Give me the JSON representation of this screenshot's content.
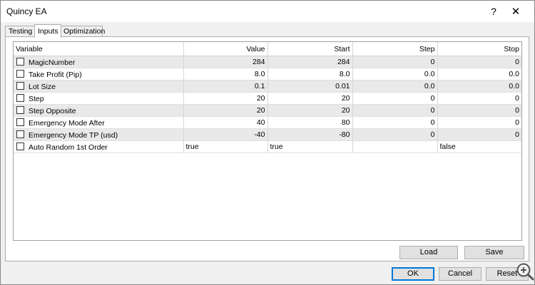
{
  "window": {
    "title": "Quincy EA",
    "help_glyph": "?",
    "close_glyph": "✕"
  },
  "tabs": [
    {
      "label": "Testing",
      "active": false
    },
    {
      "label": "Inputs",
      "active": true
    },
    {
      "label": "Optimization",
      "active": false
    }
  ],
  "table": {
    "headers": [
      "Variable",
      "Value",
      "Start",
      "Step",
      "Stop"
    ],
    "rows": [
      {
        "checked": false,
        "variable": "MagicNumber",
        "value": "284",
        "start": "284",
        "step": "0",
        "stop": "0"
      },
      {
        "checked": false,
        "variable": "Take Profit (Pip)",
        "value": "8.0",
        "start": "8.0",
        "step": "0.0",
        "stop": "0.0"
      },
      {
        "checked": false,
        "variable": "Lot Size",
        "value": "0.1",
        "start": "0.01",
        "step": "0.0",
        "stop": "0.0"
      },
      {
        "checked": false,
        "variable": "Step",
        "value": "20",
        "start": "20",
        "step": "0",
        "stop": "0"
      },
      {
        "checked": false,
        "variable": "Step Opposite",
        "value": "20",
        "start": "20",
        "step": "0",
        "stop": "0"
      },
      {
        "checked": false,
        "variable": "Emergency Mode After",
        "value": "40",
        "start": "80",
        "step": "0",
        "stop": "0"
      },
      {
        "checked": false,
        "variable": "Emergency Mode TP (usd)",
        "value": "-40",
        "start": "-80",
        "step": "0",
        "stop": "0"
      },
      {
        "checked": false,
        "variable": "Auto Random 1st Order",
        "value": "true",
        "start": "true",
        "step": "",
        "stop": "false"
      }
    ]
  },
  "buttons": {
    "load": "Load",
    "save": "Save",
    "ok": "OK",
    "cancel": "Cancel",
    "reset": "Reset"
  },
  "icons": {
    "zoom_overlay": "zoom-in-icon"
  },
  "colors": {
    "row_alt": "#e9e9e9",
    "default_button_border": "#0078d7"
  }
}
